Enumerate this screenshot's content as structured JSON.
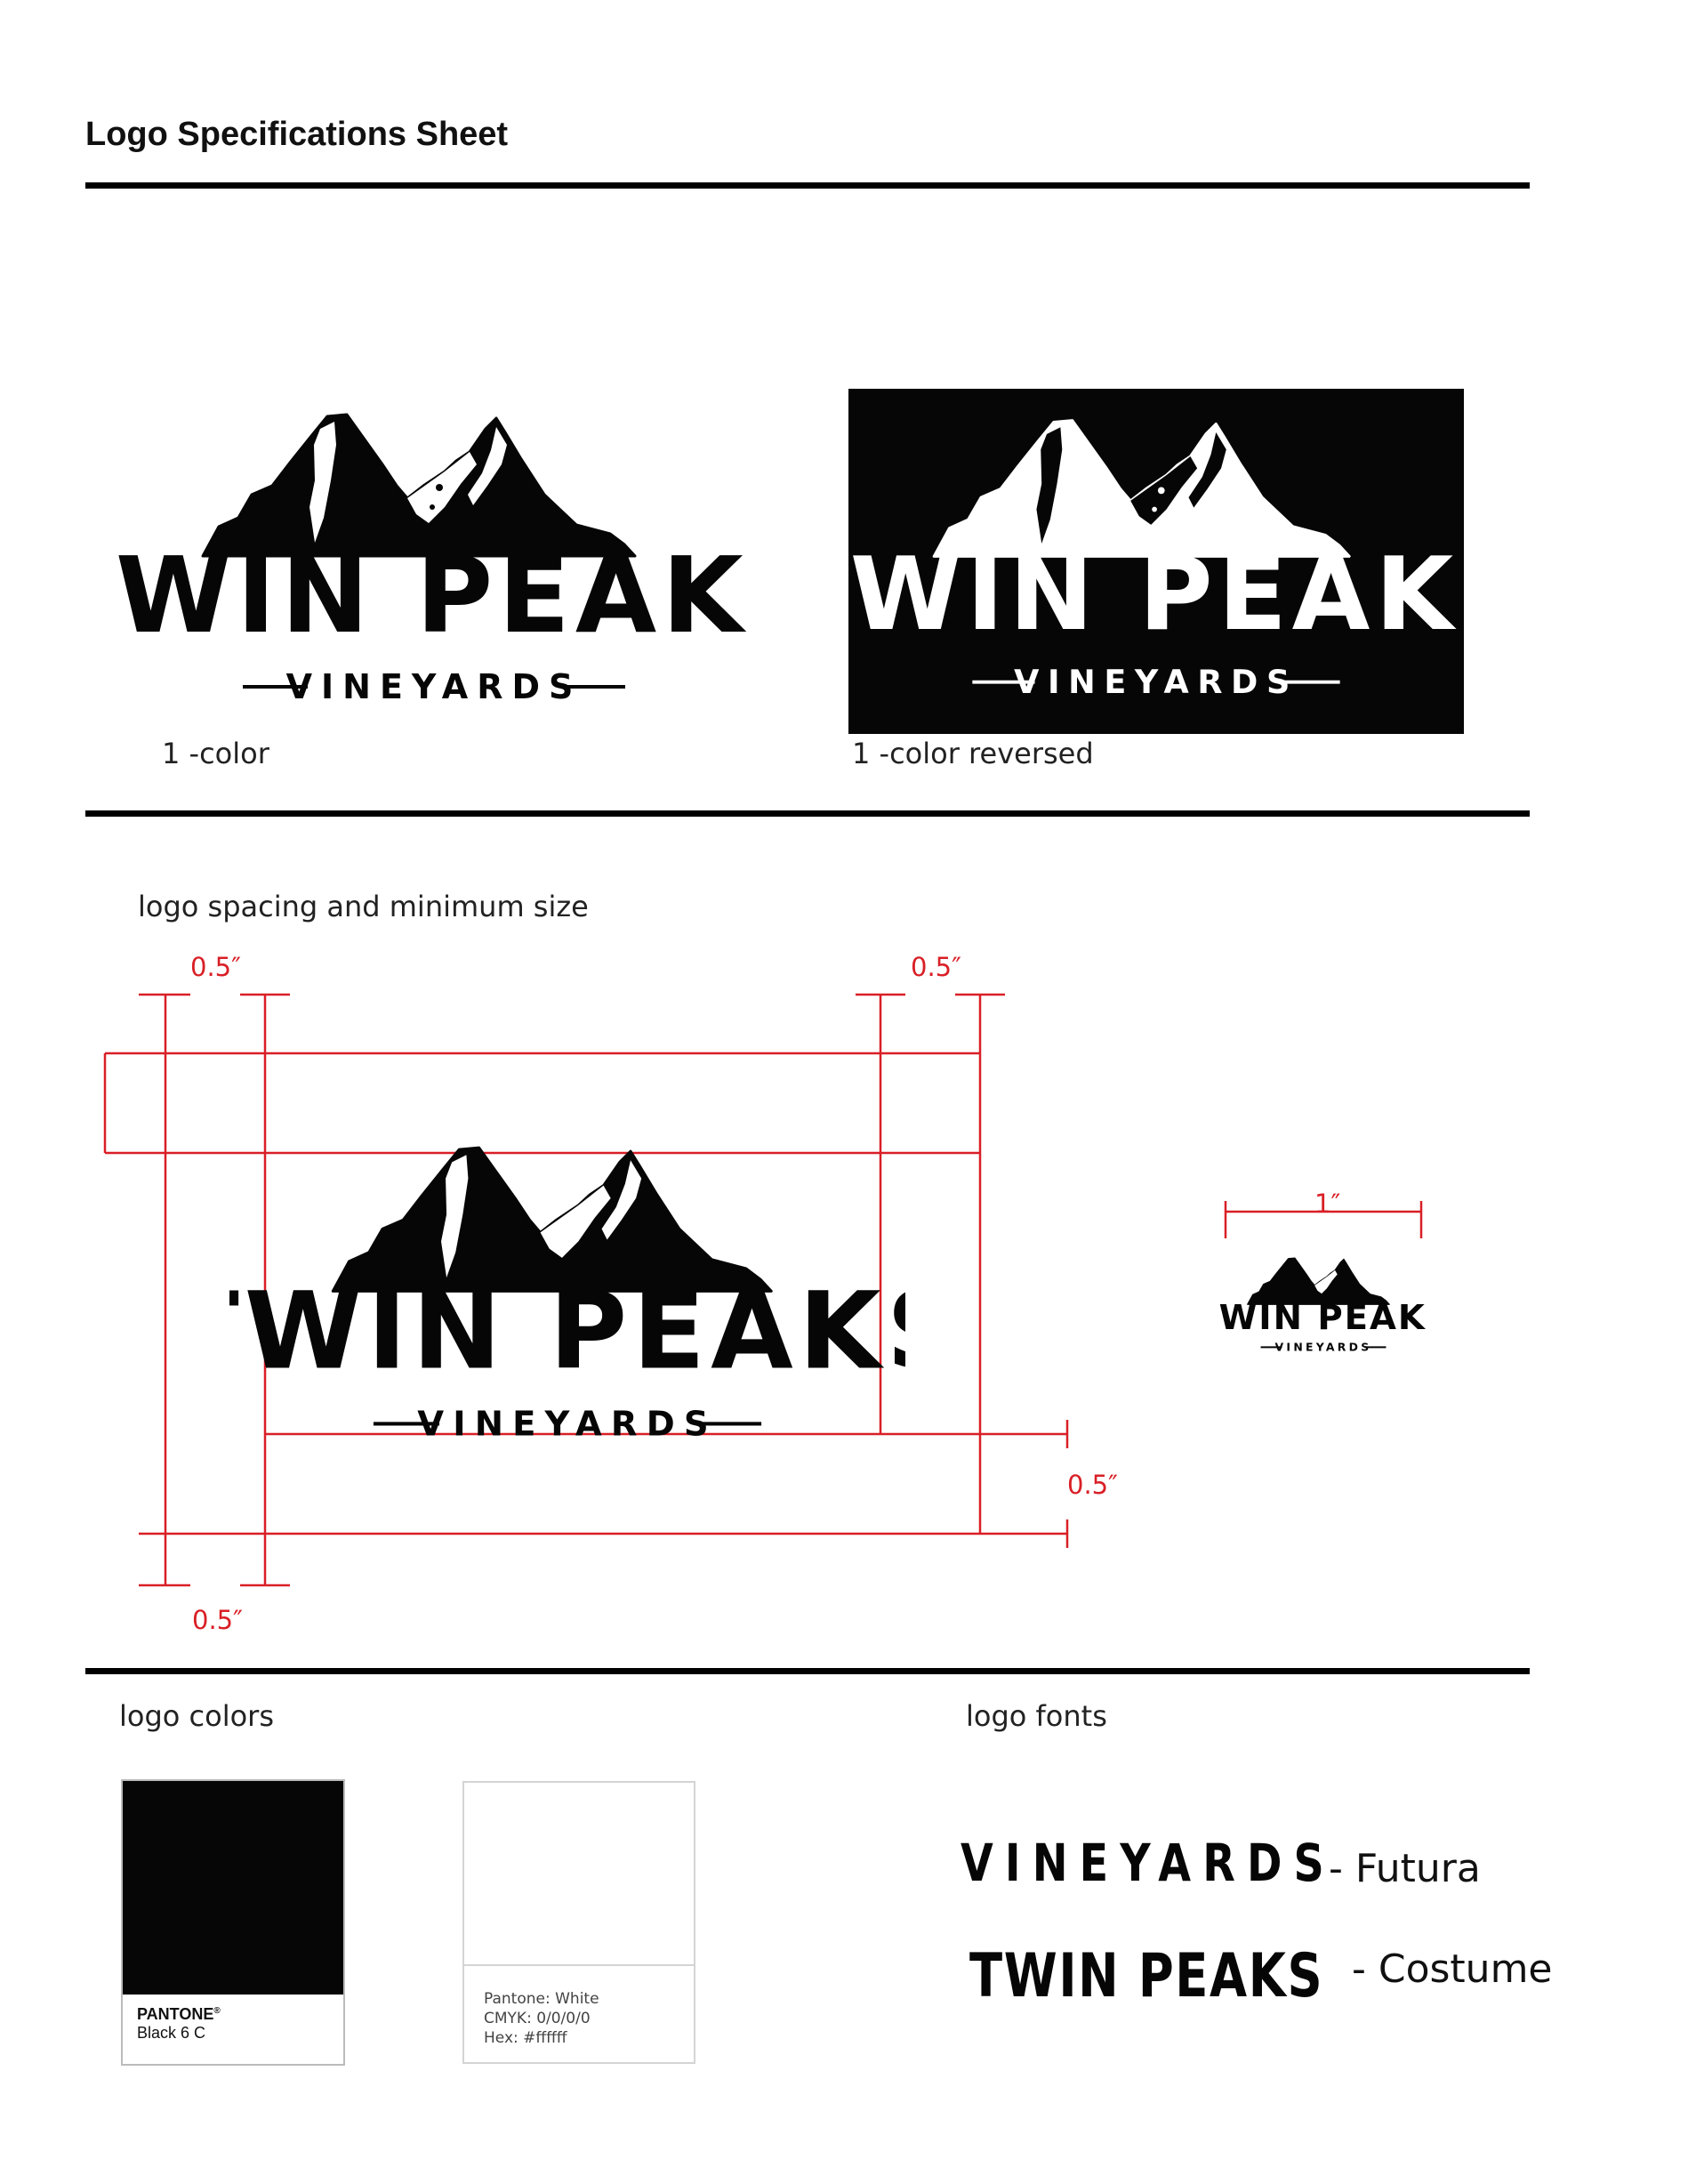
{
  "header": {
    "title": "Logo Specifications Sheet"
  },
  "logo": {
    "line1": "TWIN PEAKS",
    "line2": "VINEYARDS"
  },
  "variants": {
    "one_color": "1 -color",
    "reversed": "1 -color reversed"
  },
  "spacing": {
    "heading": "logo spacing and minimum size",
    "margin_top_left": "0.5″",
    "margin_top_right": "0.5″",
    "margin_right": "0.5″",
    "margin_bottom": "0.5″",
    "min_size": "1″"
  },
  "colors": {
    "heading": "logo colors",
    "black": {
      "brand": "PANTONE",
      "code": "Black 6 C",
      "hex": "#060606"
    },
    "white": {
      "line1": "Pantone: White",
      "line2": "CMYK: 0/0/0/0",
      "line3": "Hex: #ffffff"
    }
  },
  "fonts": {
    "heading": "logo fonts",
    "vineyards_sample": "VINEYARDS",
    "vineyards_name": "- Futura",
    "twinpeaks_sample": "TWIN PEAKS",
    "twinpeaks_name": "- Costume"
  },
  "palette": {
    "accent_red": "#d91f26",
    "ink": "#060606"
  }
}
